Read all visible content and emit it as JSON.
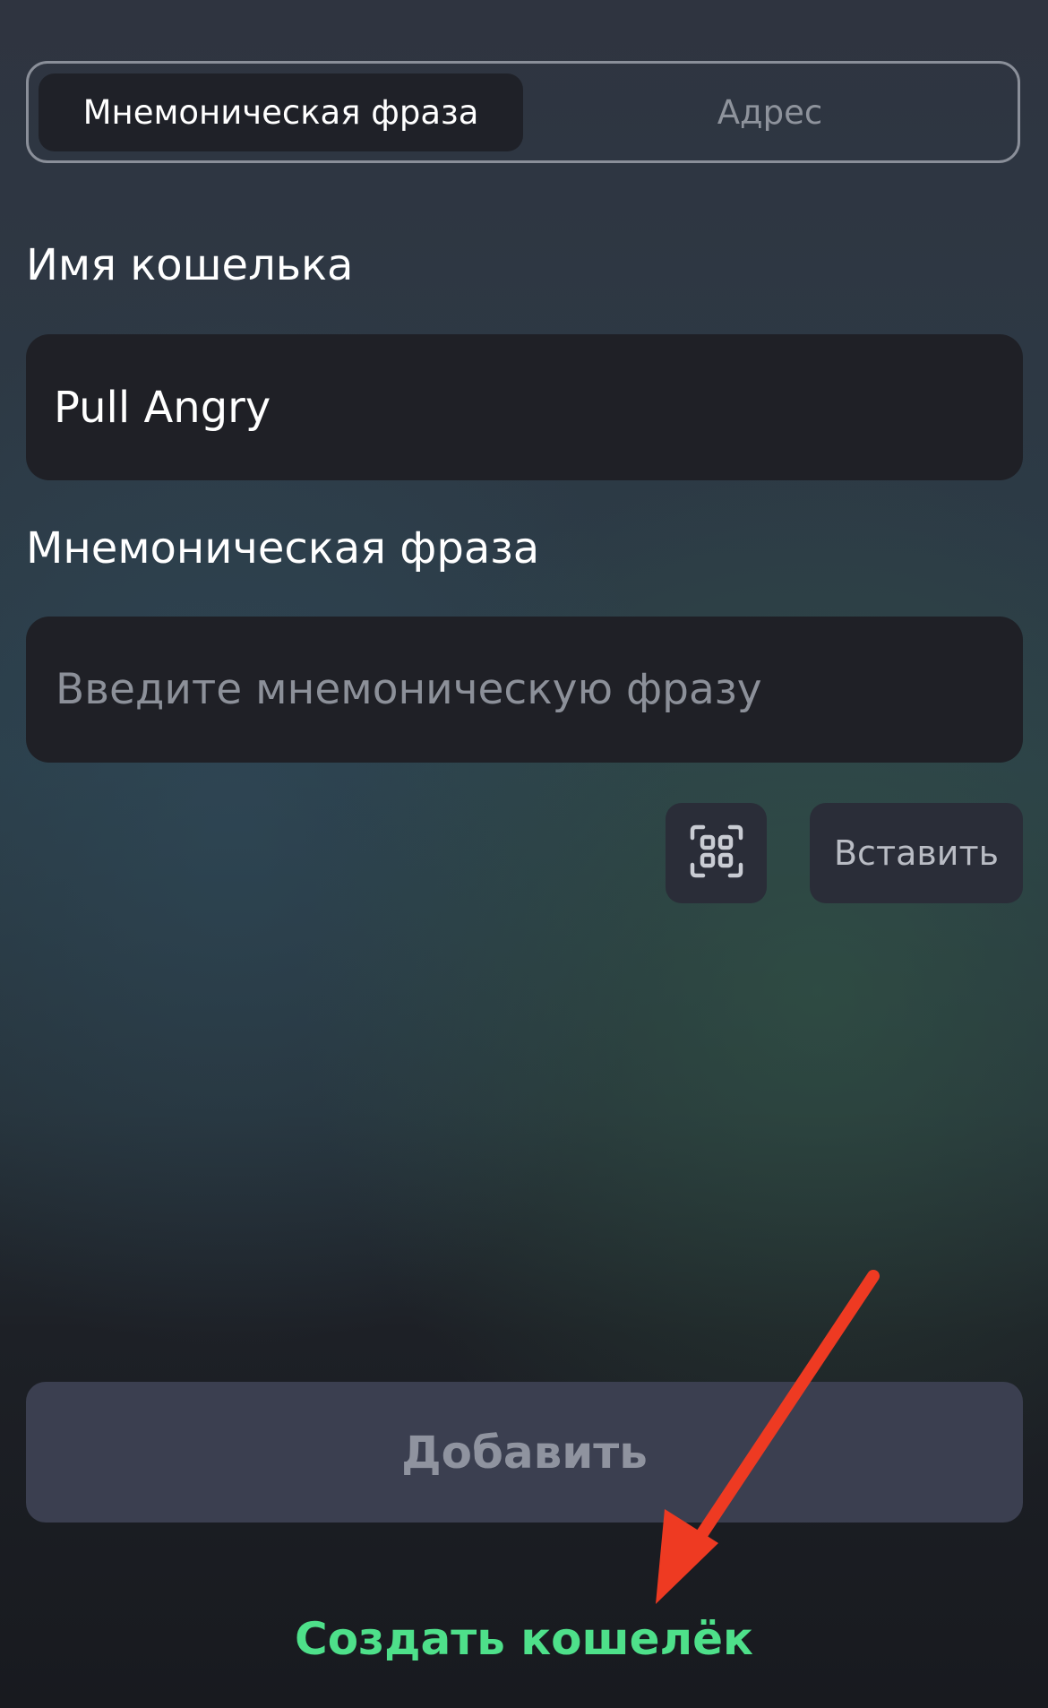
{
  "tabs": {
    "mnemonic_label": "Мнемоническая фраза",
    "address_label": "Адрес",
    "active": "mnemonic"
  },
  "wallet_name": {
    "label": "Имя кошелька",
    "value": "Pull Angry"
  },
  "mnemonic": {
    "label": "Мнемоническая фраза",
    "placeholder": "Введите мнемоническую фразу",
    "value": ""
  },
  "actions": {
    "scan_icon": "qr-scan-icon",
    "paste_label": "Вставить",
    "add_label": "Добавить",
    "create_wallet_label": "Создать кошелёк"
  },
  "colors": {
    "accent_green": "#4ee08a",
    "annotation_arrow": "#ee3a22",
    "field_bg": "#1f2026",
    "disabled_button_bg": "#3b3f50"
  }
}
